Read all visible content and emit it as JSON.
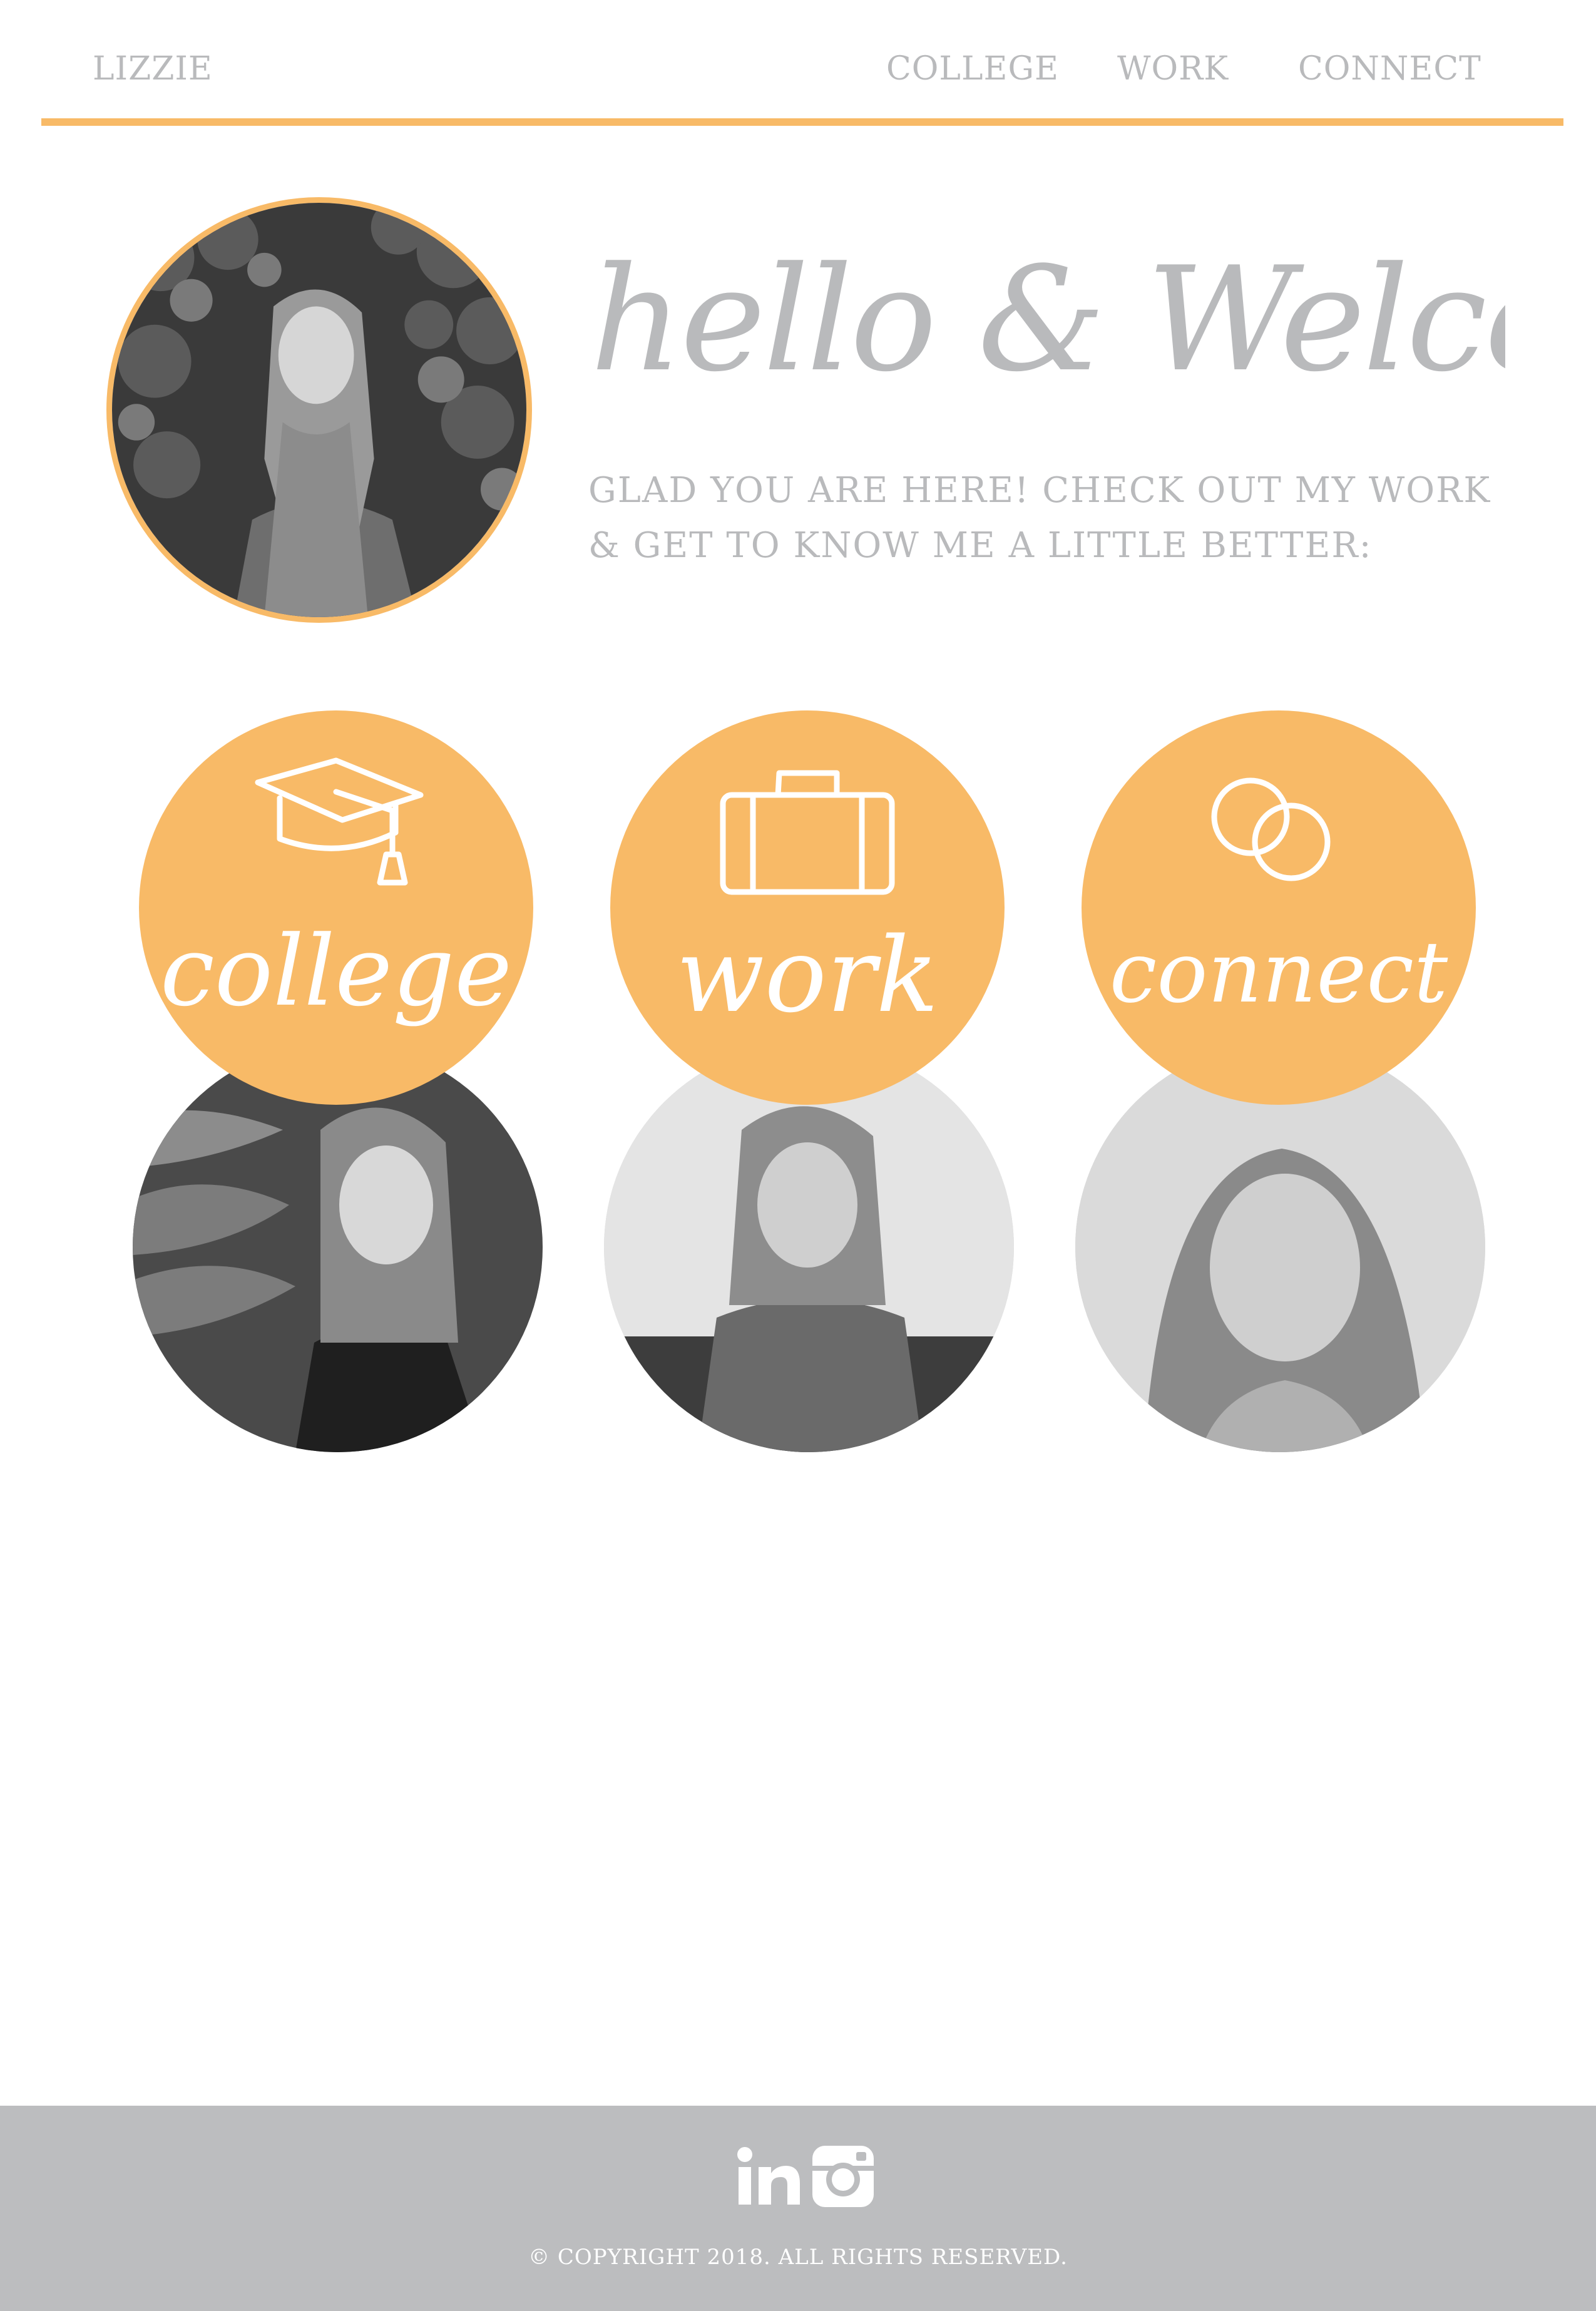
{
  "colors": {
    "accent": "#f8ba67",
    "text_gray": "#b9babc",
    "footer_bg": "#bcbdbf",
    "white": "#ffffff"
  },
  "nav": {
    "logo": "LIZZIE",
    "links": [
      "COLLEGE",
      "WORK",
      "CONNECT"
    ]
  },
  "intro": {
    "heading": "hello & Welcome",
    "lines": [
      "GLAD YOU ARE HERE! CHECK OUT MY WORK",
      "& GET TO KNOW ME A LITTLE BETTER:"
    ]
  },
  "cards": [
    {
      "label": "college",
      "icon": "graduation-cap-icon"
    },
    {
      "label": "work",
      "icon": "briefcase-icon"
    },
    {
      "label": "connect",
      "icon": "interlocking-rings-icon"
    }
  ],
  "footer": {
    "social_icons": [
      "linkedin-icon",
      "instagram-icon"
    ],
    "copyright": "© COPYRIGHT 2018. ALL RIGHTS RESERVED."
  }
}
